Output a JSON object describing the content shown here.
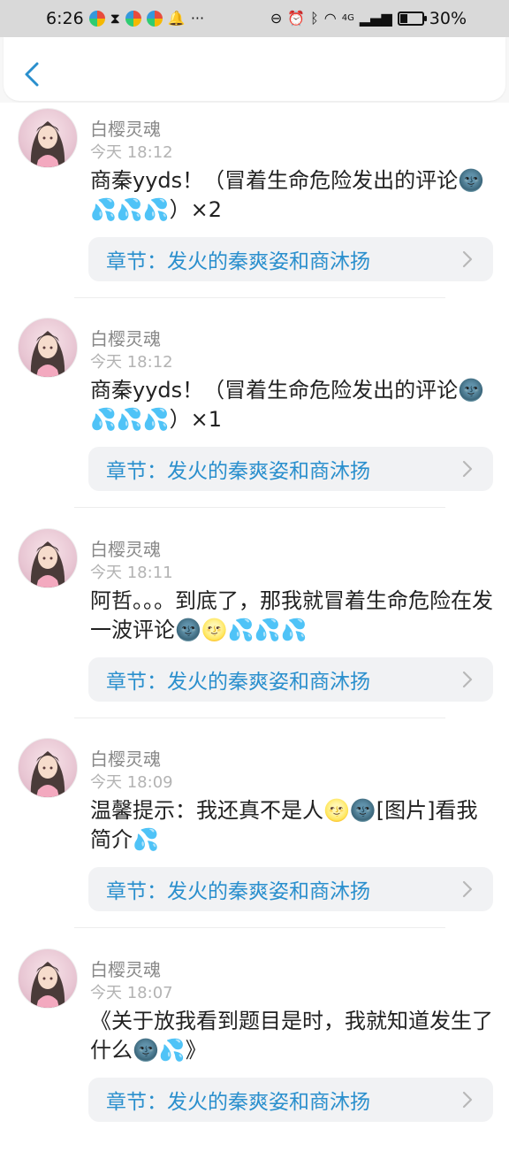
{
  "status_bar": {
    "time": "6:26",
    "network": "4G",
    "battery": "30%"
  },
  "header": {
    "back_icon": "chevron-left-icon",
    "accent": "#2a8fcd"
  },
  "comments": [
    {
      "user": "白樱灵魂",
      "time": "今天 18:12",
      "text": "商秦yyds！（冒着生命危险发出的评论🌚💦💦💦）×2",
      "chapter": "章节：发火的秦爽姿和商沐扬"
    },
    {
      "user": "白樱灵魂",
      "time": "今天 18:12",
      "text": "商秦yyds！（冒着生命危险发出的评论🌚💦💦💦）×1",
      "chapter": "章节：发火的秦爽姿和商沐扬"
    },
    {
      "user": "白樱灵魂",
      "time": "今天 18:11",
      "text": "阿哲。。。到底了，那我就冒着生命危险在发一波评论🌚🌝💦💦💦",
      "chapter": "章节：发火的秦爽姿和商沐扬"
    },
    {
      "user": "白樱灵魂",
      "time": "今天 18:09",
      "text": "温馨提示：我还真不是人🌝🌚[图片]看我简介💦",
      "chapter": "章节：发火的秦爽姿和商沐扬"
    },
    {
      "user": "白樱灵魂",
      "time": "今天 18:07",
      "text": "《关于放我看到题目是时，我就知道发生了什么🌚💦》",
      "chapter": "章节：发火的秦爽姿和商沐扬"
    }
  ]
}
